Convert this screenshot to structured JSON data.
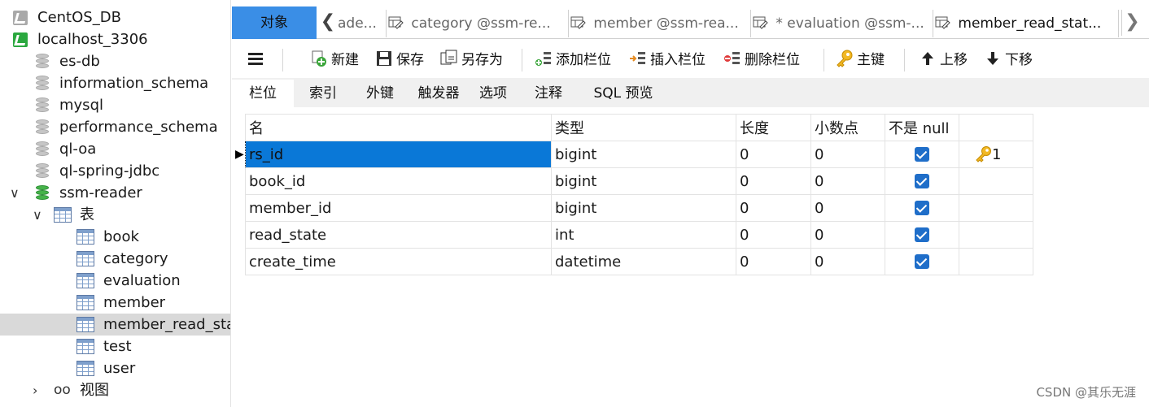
{
  "tree": {
    "items": [
      {
        "label": "CentOS_DB",
        "kind": "conn-gray",
        "level": 0
      },
      {
        "label": "localhost_3306",
        "kind": "conn-green",
        "level": 0
      },
      {
        "label": "es-db",
        "kind": "db-gray",
        "level": 1
      },
      {
        "label": "information_schema",
        "kind": "db-gray",
        "level": 1
      },
      {
        "label": "mysql",
        "kind": "db-gray",
        "level": 1
      },
      {
        "label": "performance_schema",
        "kind": "db-gray",
        "level": 1
      },
      {
        "label": "ql-oa",
        "kind": "db-gray",
        "level": 1
      },
      {
        "label": "ql-spring-jdbc",
        "kind": "db-gray",
        "level": 1
      },
      {
        "label": "ssm-reader",
        "kind": "db-green",
        "level": 1,
        "expanded": true
      },
      {
        "label": "表",
        "kind": "table-folder",
        "level": 2,
        "expanded": true
      },
      {
        "label": "book",
        "kind": "table",
        "level": 3
      },
      {
        "label": "category",
        "kind": "table",
        "level": 3
      },
      {
        "label": "evaluation",
        "kind": "table",
        "level": 3
      },
      {
        "label": "member",
        "kind": "table",
        "level": 3
      },
      {
        "label": "member_read_sta",
        "kind": "table",
        "level": 3,
        "selected": true
      },
      {
        "label": "test",
        "kind": "table",
        "level": 3
      },
      {
        "label": "user",
        "kind": "table",
        "level": 3
      },
      {
        "label": "视图",
        "kind": "view",
        "level": 2,
        "expanded": false
      }
    ]
  },
  "tabs": {
    "objects_label": "对象",
    "items": [
      {
        "label": "ade...",
        "icon": "design-table-icon"
      },
      {
        "label": "category @ssm-re...",
        "icon": "design-table-icon"
      },
      {
        "label": "member @ssm-rea...",
        "icon": "design-table-icon"
      },
      {
        "label": "* evaluation @ssm-...",
        "icon": "design-table-icon"
      },
      {
        "label": "member_read_stat...",
        "icon": "design-table-icon",
        "active": true
      }
    ]
  },
  "toolbar": {
    "new_label": "新建",
    "save_label": "保存",
    "save_as_label": "另存为",
    "add_column_label": "添加栏位",
    "insert_column_label": "插入栏位",
    "delete_column_label": "删除栏位",
    "primary_key_label": "主键",
    "move_up_label": "上移",
    "move_down_label": "下移"
  },
  "subtabs": {
    "items": [
      "栏位",
      "索引",
      "外键",
      "触发器",
      "选项",
      "注释",
      "SQL 预览"
    ],
    "active_index": 0
  },
  "grid": {
    "headers": {
      "name": "名",
      "type": "类型",
      "length": "长度",
      "decimals": "小数点",
      "not_null": "不是 null",
      "key": ""
    },
    "rows": [
      {
        "name": "rs_id",
        "type": "bigint",
        "length": "0",
        "decimals": "0",
        "not_null": true,
        "key": "1"
      },
      {
        "name": "book_id",
        "type": "bigint",
        "length": "0",
        "decimals": "0",
        "not_null": true,
        "key": ""
      },
      {
        "name": "member_id",
        "type": "bigint",
        "length": "0",
        "decimals": "0",
        "not_null": true,
        "key": ""
      },
      {
        "name": "read_state",
        "type": "int",
        "length": "0",
        "decimals": "0",
        "not_null": true,
        "key": ""
      },
      {
        "name": "create_time",
        "type": "datetime",
        "length": "0",
        "decimals": "0",
        "not_null": true,
        "key": ""
      }
    ]
  },
  "watermark": "CSDN @其乐无涯",
  "colors": {
    "accent": "#3a8ee6",
    "selection": "#0a78d7",
    "checkbox": "#1f6ec9",
    "tree_selected": "#d9d9d9"
  }
}
